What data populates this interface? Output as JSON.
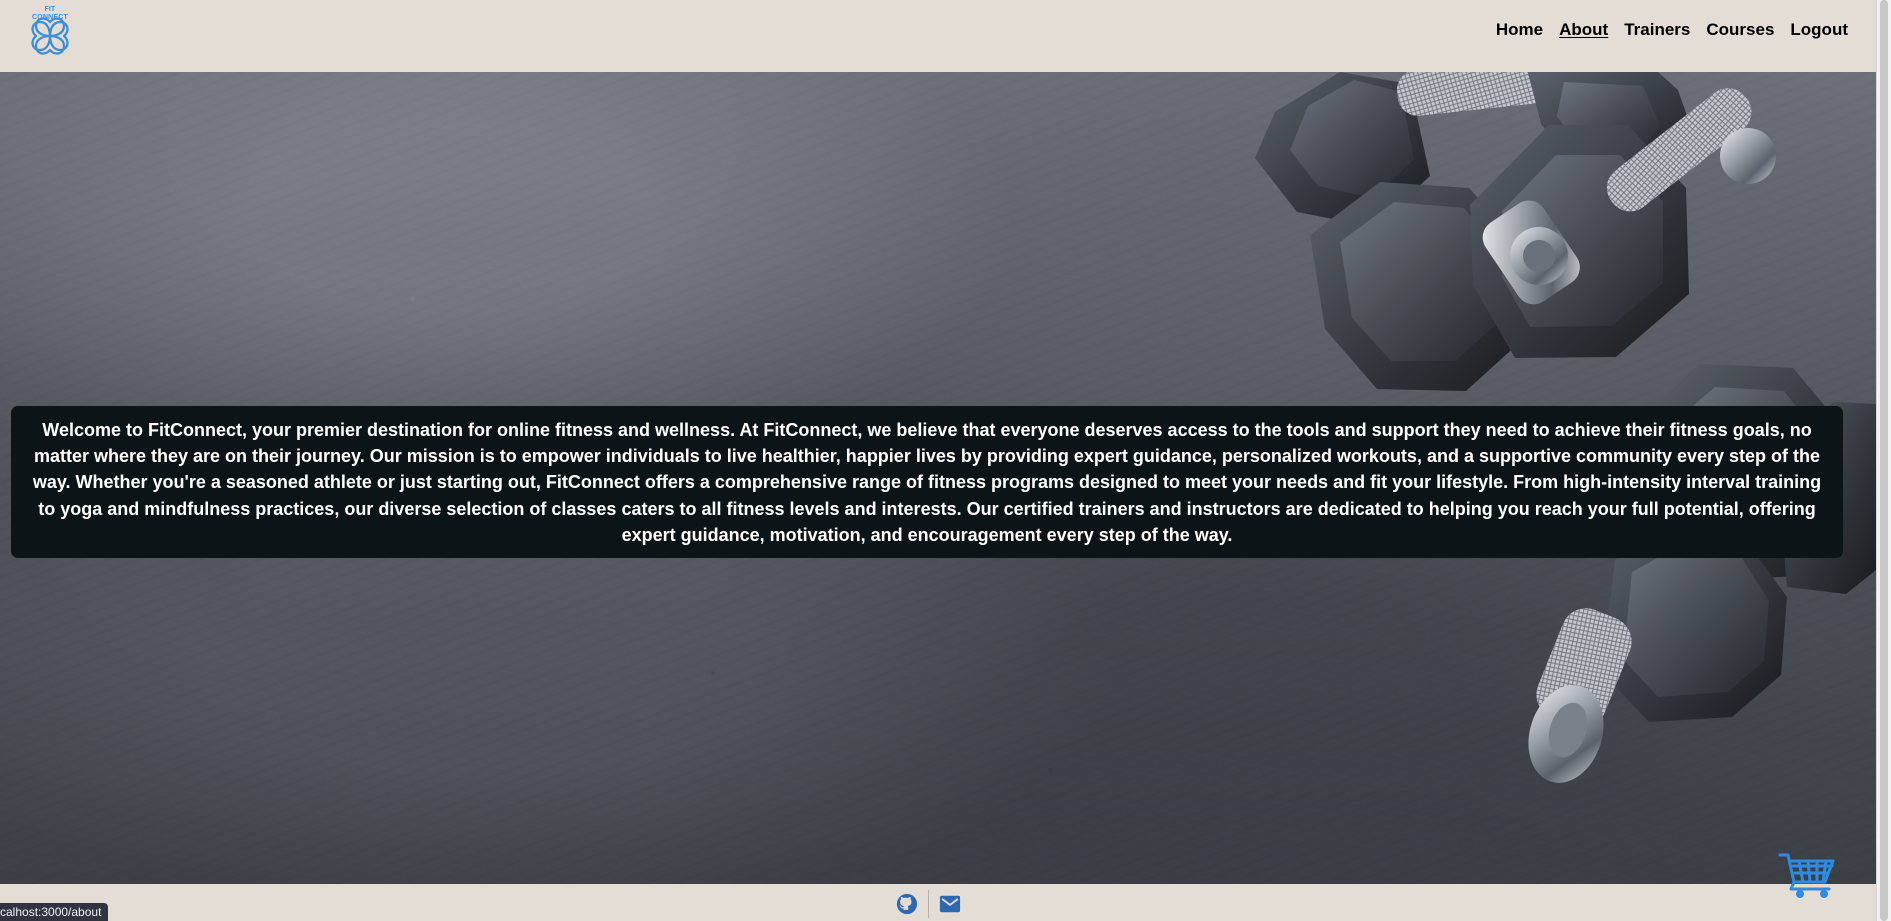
{
  "header": {
    "logo_text": "FIT CONNECT",
    "nav": {
      "home": "Home",
      "about": "About",
      "trainers": "Trainers",
      "courses": "Courses",
      "logout": "Logout"
    },
    "active_item": "About"
  },
  "about": {
    "text": "Welcome to FitConnect, your premier destination for online fitness and wellness. At FitConnect, we believe that everyone deserves access to the tools and support they need to achieve their fitness goals, no matter where they are on their journey. Our mission is to empower individuals to live healthier, happier lives by providing expert guidance, personalized workouts, and a supportive community every step of the way. Whether you're a seasoned athlete or just starting out, FitConnect offers a comprehensive range of fitness programs designed to meet your needs and fit your lifestyle. From high-intensity interval training to yoga and mindfulness practices, our diverse selection of classes caters to all fitness levels and interests. Our certified trainers and instructors are dedicated to helping you reach your full potential, offering expert guidance, motivation, and encouragement every step of the way."
  },
  "footer": {
    "icons": [
      "github-icon",
      "mail-icon"
    ]
  },
  "status_bar": {
    "url": "calhost:3000/about"
  },
  "cart": {
    "icon": "shopping-cart-icon"
  },
  "colors": {
    "page_background": "#e4ddd6",
    "text_box_background": "#0d1417",
    "brand_blue": "#3e8ed6",
    "footer_icon_blue": "#2f68b0"
  }
}
